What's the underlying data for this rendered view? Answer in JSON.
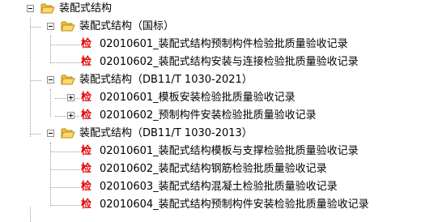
{
  "icons": {
    "folder": "open-folder-icon",
    "check": "检"
  },
  "colors": {
    "check_icon": "#e00000",
    "folder": "#f5c542"
  },
  "tree": {
    "root": {
      "label": "装配式结构",
      "expanded": true
    },
    "groups": [
      {
        "label": "装配式结构（国标）",
        "expanded": true,
        "items": [
          {
            "icon": "检",
            "label": "02010601_装配式结构预制构件检验批质量验收记录"
          },
          {
            "icon": "检",
            "label": "02010602_装配式结构安装与连接检验批质量验收记录"
          }
        ]
      },
      {
        "label": "装配式结构（DB11/T 1030-2021）",
        "expanded": true,
        "items": [
          {
            "icon": "检",
            "label": "02010601_模板安装检验批质量验收记录",
            "expandable": true
          },
          {
            "icon": "检",
            "label": "02010602_预制构件安装检验批质量验收记录",
            "expandable": true
          }
        ]
      },
      {
        "label": "装配式结构（DB11/T 1030-2013）",
        "expanded": true,
        "items": [
          {
            "icon": "检",
            "label": "02010601_装配式结构模板与支撑检验批质量验收记录"
          },
          {
            "icon": "检",
            "label": "02010602_装配式结构钢筋检验批质量验收记录"
          },
          {
            "icon": "检",
            "label": "02010603_装配式结构混凝土检验批质量验收记录"
          },
          {
            "icon": "检",
            "label": "02010604_装配式结构预制构件安装检验批质量验收记录"
          }
        ]
      }
    ]
  }
}
